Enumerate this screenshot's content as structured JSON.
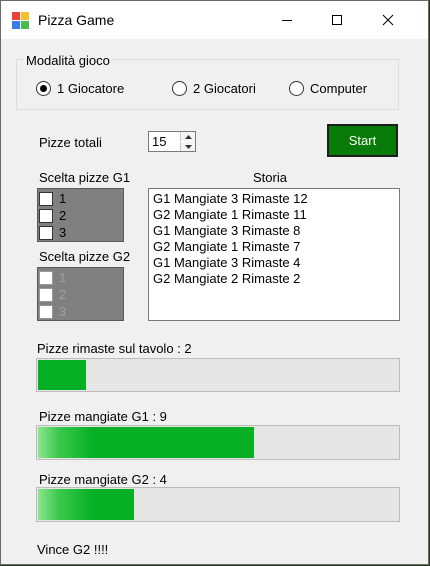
{
  "window": {
    "title": "Pizza Game"
  },
  "mode_group": {
    "title": "Modalità gioco",
    "options": [
      {
        "label": "1 Giocatore",
        "selected": true
      },
      {
        "label": "2 Giocatori",
        "selected": false
      },
      {
        "label": "Computer",
        "selected": false
      }
    ]
  },
  "total": {
    "label": "Pizze totali",
    "value": "15"
  },
  "start_button": {
    "label": "Start",
    "color": "#077a07"
  },
  "g1_choice": {
    "label": "Scelta pizze G1",
    "items": [
      "1",
      "2",
      "3"
    ],
    "enabled": true
  },
  "g2_choice": {
    "label": "Scelta pizze G2",
    "items": [
      "1",
      "2",
      "3"
    ],
    "enabled": false
  },
  "history": {
    "label": "Storia",
    "lines": [
      "G1 Mangiate 3 Rimaste 12",
      "G2 Mangiate 1 Rimaste 11",
      "G1 Mangiate 3 Rimaste 8",
      "G2 Mangiate 1 Rimaste 7",
      "G1 Mangiate 3 Rimaste 4",
      "G2 Mangiate 2 Rimaste 2"
    ]
  },
  "progress": {
    "remaining": {
      "label": "Pizze rimaste sul tavolo :  2",
      "fraction": 0.133
    },
    "g1": {
      "label": "Pizze mangiate G1 :  9",
      "fraction": 0.6
    },
    "g2": {
      "label": "Pizze mangiate G2 :  4",
      "fraction": 0.267
    }
  },
  "result": "Vince G2 !!!!",
  "colors": {
    "progress_fill": "#06b025",
    "list_bg": "#808080"
  }
}
